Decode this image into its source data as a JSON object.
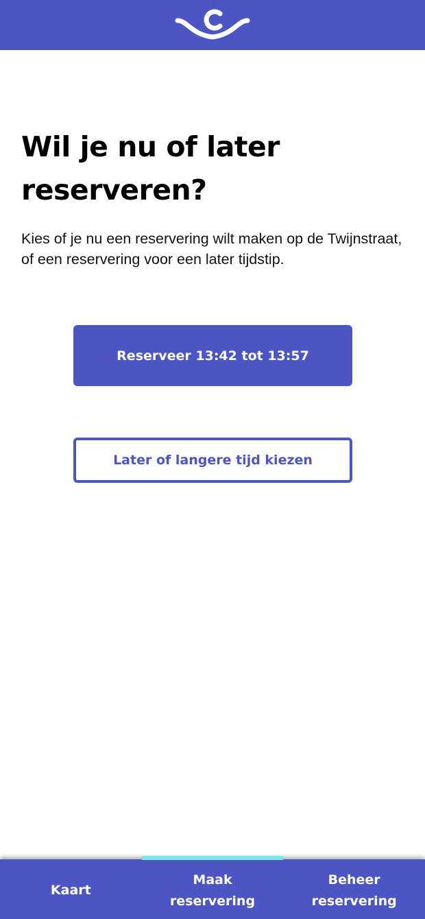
{
  "colors": {
    "brand": "#4b55c4",
    "active_indicator": "#7ee8e8",
    "background": "#ffffff"
  },
  "header": {
    "logo_icon": "cycle-c-logo-icon"
  },
  "main": {
    "title": "Wil je nu of later reserveren?",
    "subtitle": "Kies of je nu een reservering wilt maken op de Twijnstraat, of een reservering voor een later tijdstip.",
    "reserve_now_label": "Reserveer 13:42 tot 13:57",
    "reserve_later_label": "Later of langere tijd kiezen"
  },
  "bottom_nav": {
    "items": [
      {
        "label": "Kaart",
        "active": false
      },
      {
        "label": "Maak reservering",
        "active": true
      },
      {
        "label": "Beheer reservering",
        "active": false
      }
    ]
  }
}
